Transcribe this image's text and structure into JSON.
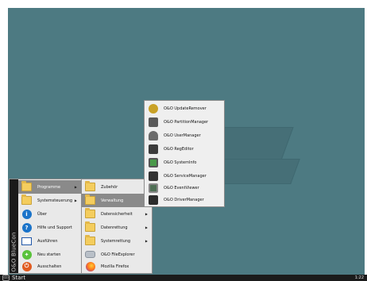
{
  "taskbar": {
    "start_label": "Start",
    "start_logo": "(O)",
    "clock": "1:22"
  },
  "start_menu": {
    "brand": "O&O BlueCon",
    "items": [
      {
        "label": "Programme",
        "icon": "folder-icon",
        "submenu": true
      },
      {
        "label": "Systemsteuerung",
        "icon": "folder-icon",
        "submenu": true
      },
      {
        "label": "Über",
        "icon": "info-icon",
        "glyph": "i"
      },
      {
        "label": "Hilfe und Support",
        "icon": "help-icon",
        "glyph": "?"
      },
      {
        "label": "Ausführen",
        "icon": "run-icon"
      },
      {
        "label": "Neu starten",
        "icon": "restart-icon"
      },
      {
        "label": "Ausschalten",
        "icon": "shutdown-icon"
      }
    ]
  },
  "programme_menu": {
    "items": [
      {
        "label": "Zubehör",
        "icon": "folder-icon",
        "submenu": true
      },
      {
        "label": "Verwaltung",
        "icon": "folder-icon",
        "submenu": true
      },
      {
        "label": "Datensicherheit",
        "icon": "folder-icon",
        "submenu": true
      },
      {
        "label": "Datenrettung",
        "icon": "folder-icon",
        "submenu": true
      },
      {
        "label": "Systemrettung",
        "icon": "folder-icon",
        "submenu": true
      },
      {
        "label": "O&O FileExplorer",
        "icon": "file-explorer-icon"
      },
      {
        "label": "Mozilla Firefox",
        "icon": "firefox-icon"
      }
    ]
  },
  "verwaltung_menu": {
    "items": [
      {
        "label": "O&O UpdateRemover",
        "icon": "update-remover-icon",
        "color": "#c9a227"
      },
      {
        "label": "O&O PartitionManager",
        "icon": "partition-manager-icon",
        "color": "#5a5a5a"
      },
      {
        "label": "O&O UserManager",
        "icon": "user-manager-icon",
        "color": "#6b6b6b"
      },
      {
        "label": "O&O RegEditor",
        "icon": "reg-editor-icon",
        "color": "#3c3c3c"
      },
      {
        "label": "O&O SystemInfo",
        "icon": "system-info-icon",
        "color": "#4a9a4a"
      },
      {
        "label": "O&O ServiceManager",
        "icon": "service-manager-icon",
        "color": "#333333"
      },
      {
        "label": "O&O EventViewer",
        "icon": "event-viewer-icon",
        "color": "#4f6f55"
      },
      {
        "label": "O&O DriverManager",
        "icon": "driver-manager-icon",
        "color": "#2c2c2c"
      }
    ]
  },
  "colors": {
    "desktop": "#4d7a82",
    "highlight": "#8a8a8a",
    "menu_bg": "#e9e9e9",
    "taskbar": "#1b1b1b"
  }
}
